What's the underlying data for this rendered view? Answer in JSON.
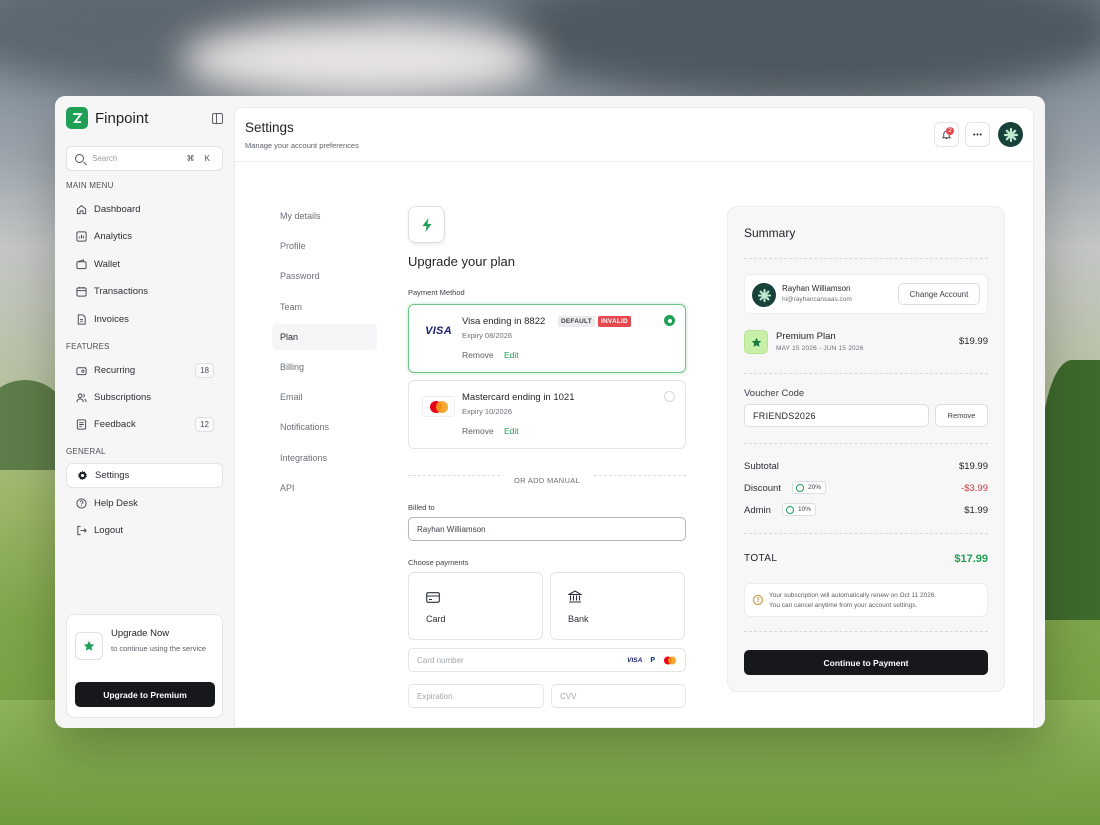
{
  "app": {
    "name": "Finpoint"
  },
  "search": {
    "placeholder": "Search",
    "shortcut": "⌘ K"
  },
  "sidebar": {
    "main_menu_title": "MAIN MENU",
    "main_items": [
      {
        "label": "Dashboard",
        "icon": "home-icon"
      },
      {
        "label": "Analytics",
        "icon": "chart-icon"
      },
      {
        "label": "Wallet",
        "icon": "wallet-icon"
      },
      {
        "label": "Transactions",
        "icon": "calendar-icon"
      },
      {
        "label": "Invoices",
        "icon": "file-icon"
      }
    ],
    "features_title": "FEATURES",
    "feature_items": [
      {
        "label": "Recurring",
        "icon": "recurring-icon",
        "count": "18"
      },
      {
        "label": "Subscriptions",
        "icon": "users-icon"
      },
      {
        "label": "Feedback",
        "icon": "feedback-icon",
        "count": "12"
      }
    ],
    "general_title": "GENERAL",
    "general_items": [
      {
        "label": "Settings",
        "icon": "gear-icon"
      },
      {
        "label": "Help Desk",
        "icon": "help-icon"
      },
      {
        "label": "Logout",
        "icon": "logout-icon"
      }
    ],
    "upgrade": {
      "title": "Upgrade Now",
      "description": "to continue using the service",
      "button": "Upgrade to Premium"
    }
  },
  "header": {
    "title": "Settings",
    "subtitle": "Manage your account preferences",
    "notification_count": "2"
  },
  "tabs": [
    "My details",
    "Profile",
    "Password",
    "Team",
    "Plan",
    "Billing",
    "Email",
    "Notifications",
    "Integrations",
    "API"
  ],
  "plan": {
    "title": "Upgrade your plan",
    "payment_method_label": "Payment Method",
    "cards": [
      {
        "brand": "VISA",
        "name": "Visa ending in 8822",
        "expiry": "Expiry 08/2026",
        "tag_default": "DEFAULT",
        "tag_invalid": "INVALID",
        "remove": "Remove",
        "edit": "Edit"
      },
      {
        "brand": "Mastercard",
        "name": "Mastercard ending in 1021",
        "expiry": "Expiry 10/2026",
        "remove": "Remove",
        "edit": "Edit"
      }
    ],
    "or_add_manual": "OR ADD MANUAL",
    "billed_to_label": "Billed to",
    "billed_to_value": "Rayhan Williamson",
    "choose_payments_label": "Choose payments",
    "options": [
      "Card",
      "Bank"
    ],
    "card_number_placeholder": "Card number",
    "mini_visa": "VISA",
    "mini_paypal": "P",
    "expiration_placeholder": "Expiration",
    "cvv_placeholder": "CVV"
  },
  "summary": {
    "title": "Summary",
    "user_name": "Rayhan Williamson",
    "user_email": "hi@rayhancansaas.com",
    "change_account": "Change Account",
    "plan_name": "Premium Plan",
    "plan_dates": "MAY 15 2026 - JUN 15 2026",
    "plan_price": "$19.99",
    "voucher_label": "Voucher Code",
    "voucher_value": "FRIENDS2026",
    "voucher_remove": "Remove",
    "subtotal_label": "Subtotal",
    "subtotal_value": "$19.99",
    "discount_label": "Discount",
    "discount_pct": "20%",
    "discount_value": "-$3.99",
    "admin_label": "Admin",
    "admin_pct": "10%",
    "admin_value": "$1.99",
    "total_label": "TOTAL",
    "total_value": "$17.99",
    "notice_line1": "Your subscription will automatically renew on Oct 11 2026.",
    "notice_line2": "You can cancel anytime from your account settings.",
    "continue_button": "Continue to Payment"
  },
  "colors": {
    "accent": "#1fa055",
    "danger": "#e5484d",
    "dark": "#16181b"
  }
}
